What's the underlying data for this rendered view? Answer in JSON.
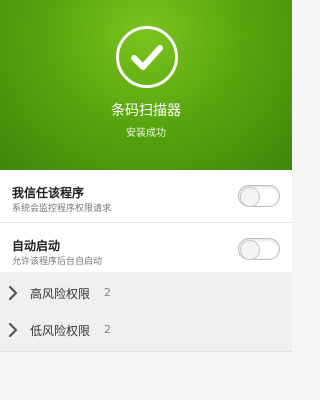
{
  "app": {
    "name": "条码扫描器",
    "status": "安装成功",
    "status_icon": "check-icon",
    "accent": "#5aa812"
  },
  "settings": [
    {
      "title": "我信任该程序",
      "subtitle": "系统会监控程序权限请求",
      "enabled": false
    },
    {
      "title": "自动启动",
      "subtitle": "允许该程序后台自启动",
      "enabled": false
    }
  ],
  "permissions": [
    {
      "label": "高风险权限",
      "count": "2",
      "icon": "chevron-right-icon"
    },
    {
      "label": "低风险权限",
      "count": "2",
      "icon": "chevron-right-icon"
    }
  ]
}
